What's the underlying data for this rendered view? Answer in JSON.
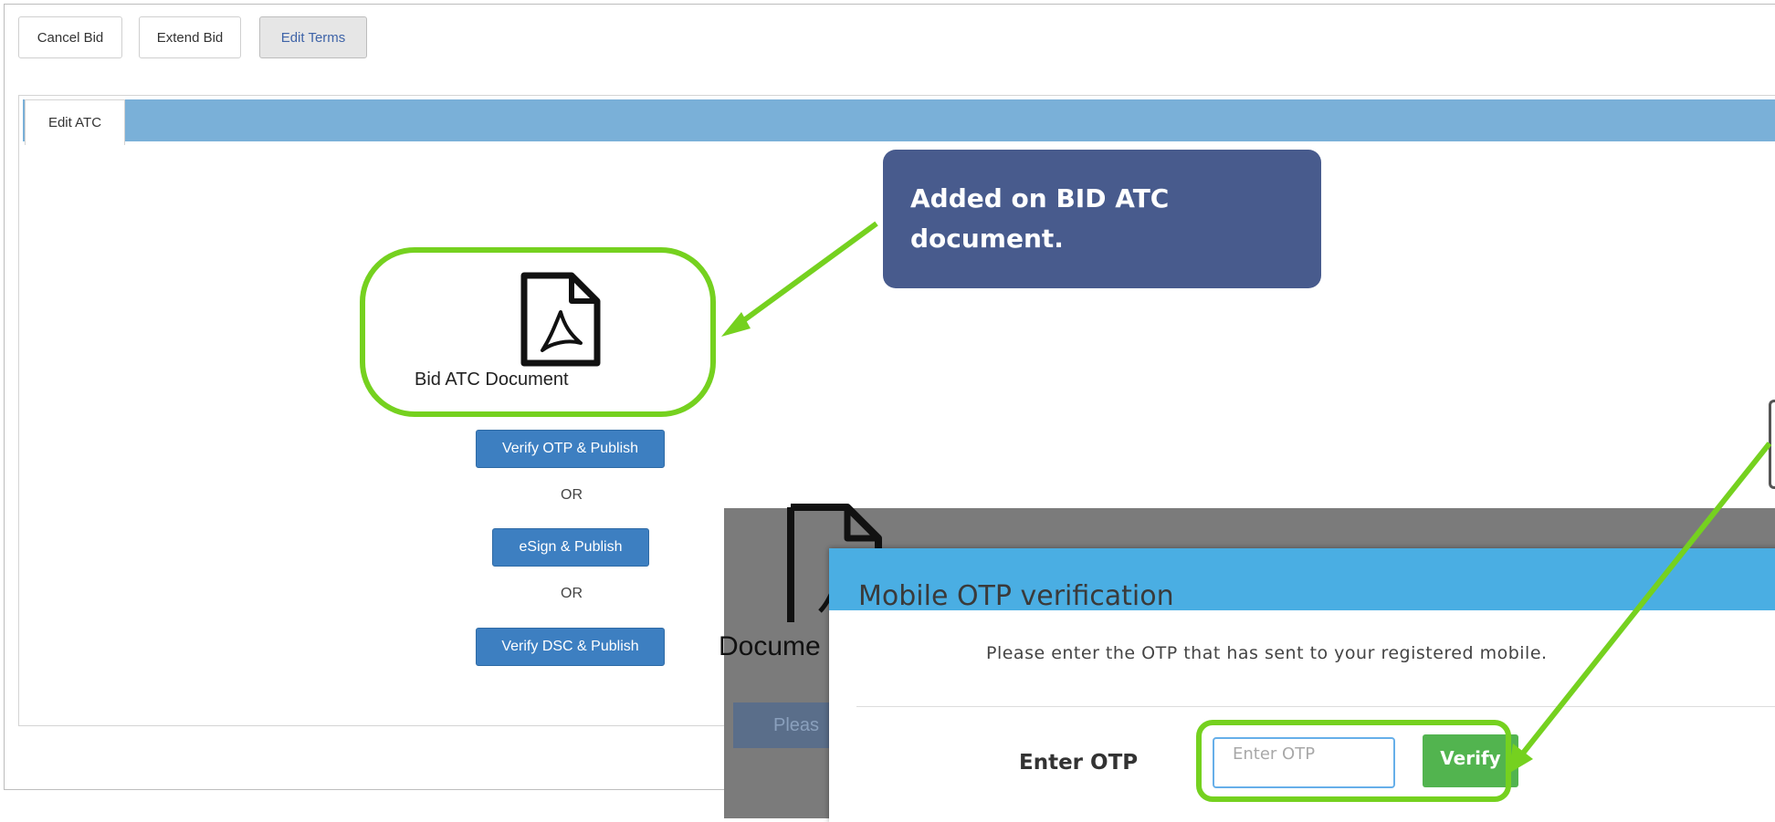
{
  "toolbar": {
    "cancel_label": "Cancel Bid",
    "extend_label": "Extend Bid",
    "edit_terms_label": "Edit Terms"
  },
  "tabs": [
    {
      "label": "Edit ATC",
      "active": true
    }
  ],
  "document": {
    "label": "Bid ATC Document",
    "icon": "pdf-file-icon"
  },
  "actions": {
    "verify_otp_label": "Verify OTP & Publish",
    "or_1": "OR",
    "esign_label": "eSign & Publish",
    "or_2": "OR",
    "verify_dsc_label": "Verify DSC & Publish"
  },
  "callout": {
    "text": "Added on BID ATC document."
  },
  "overlay": {
    "doc_label": "Docume",
    "button_label": "Pleas"
  },
  "modal": {
    "title": "Mobile OTP verification",
    "message": "Please enter the OTP that has sent to your registered mobile.",
    "otp_label": "Enter OTP",
    "otp_placeholder": "Enter OTP",
    "verify_label": "Verify"
  },
  "colors": {
    "highlight": "#75d11f",
    "callout_bg": "#485b8d",
    "primary_button": "#3d7fc1",
    "modal_header": "#4aaee3",
    "verify_button": "#52b44f",
    "tab_strip": "#7ab0d8"
  }
}
